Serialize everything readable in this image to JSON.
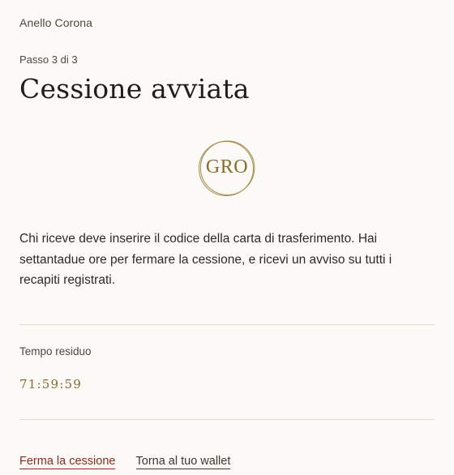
{
  "brand": "Anello Corona",
  "step": "Passo 3 di 3",
  "title": "Cessione avviata",
  "seal": {
    "text": "GRO",
    "color": "#8a6a2e"
  },
  "description": "Chi riceve deve inserire il codice della carta di trasferimento. Hai settantadue ore per fermare la cessione, e ricevi un avviso su tutti i recapiti registrati.",
  "timer": {
    "label": "Tempo residuo",
    "value": "71:59:59"
  },
  "actions": {
    "stop_label": "Ferma la cessione",
    "back_label": "Torna al tuo wallet"
  },
  "colors": {
    "background": "#fbfaf6",
    "accent_gold": "#8a6a2e",
    "danger": "#8d2a1f"
  }
}
